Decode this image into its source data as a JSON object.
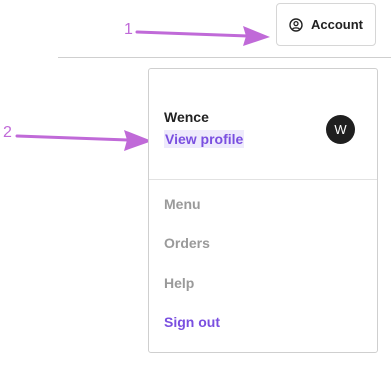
{
  "annotations": [
    "1",
    "2"
  ],
  "header": {
    "account_label": "Account"
  },
  "dropdown": {
    "user_name": "Wence",
    "view_profile_label": "View profile",
    "avatar_initial": "W",
    "items": [
      {
        "label": "Menu"
      },
      {
        "label": "Orders"
      },
      {
        "label": "Help"
      },
      {
        "label": "Sign out"
      }
    ]
  },
  "colors": {
    "accent": "#7a4fe0",
    "annotation": "#c06ad8",
    "muted_text": "#9a9a9a",
    "avatar_bg": "#1f1f1f"
  },
  "icons": {
    "account": "user-circle-icon"
  }
}
